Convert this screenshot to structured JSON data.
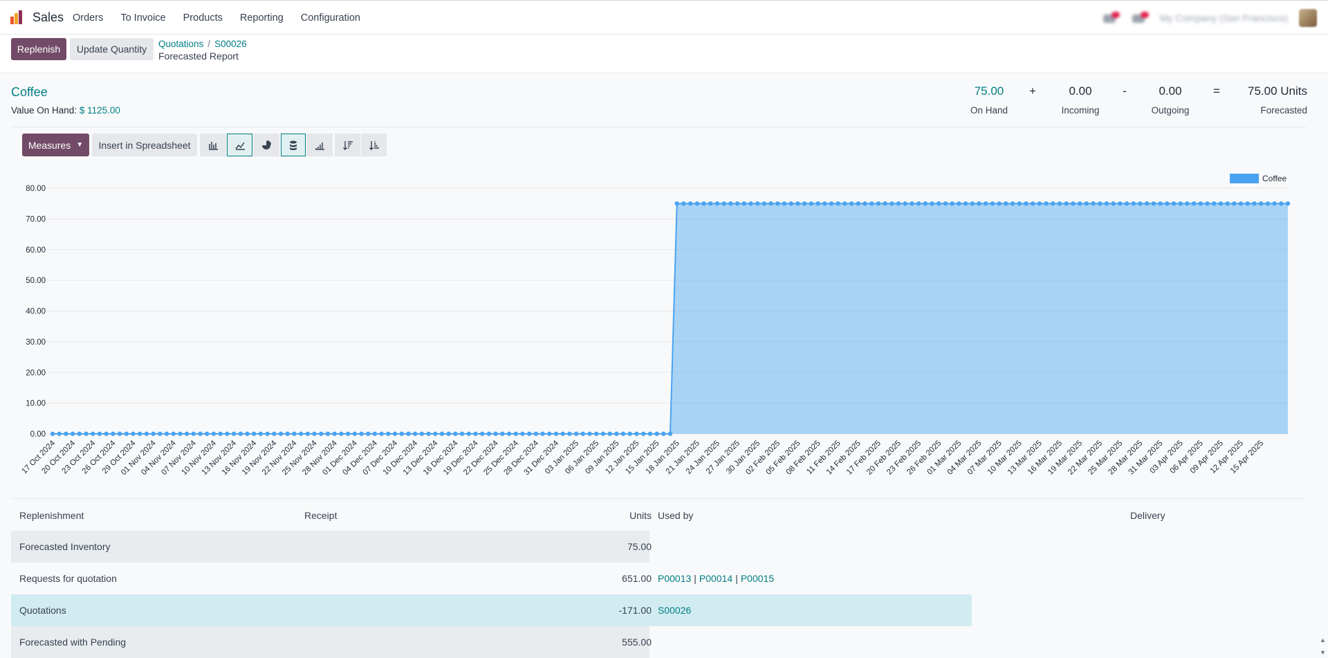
{
  "app": {
    "name": "Sales"
  },
  "menu": [
    "Orders",
    "To Invoice",
    "Products",
    "Reporting",
    "Configuration"
  ],
  "navbar_right": {
    "company": "My Company (San Francisco)"
  },
  "control": {
    "replenish_label": "Replenish",
    "update_quantity_label": "Update Quantity",
    "breadcrumb": [
      "Quotations",
      "S00026"
    ],
    "current": "Forecasted Report"
  },
  "product": {
    "name": "Coffee",
    "value_on_hand_label": "Value On Hand:",
    "value_on_hand": "$ 1125.00"
  },
  "summary": {
    "on_hand": {
      "value": "75.00",
      "label": "On Hand"
    },
    "plus": "+",
    "incoming": {
      "value": "0.00",
      "label": "Incoming"
    },
    "minus": "-",
    "outgoing": {
      "value": "0.00",
      "label": "Outgoing"
    },
    "equals": "=",
    "forecasted": {
      "value": "75.00 Units",
      "label": "Forecasted"
    }
  },
  "toolbar": {
    "measures_label": "Measures",
    "insert_label": "Insert in Spreadsheet",
    "icons": [
      "bar-chart-icon",
      "line-chart-icon",
      "pie-chart-icon",
      "stacked-icon",
      "cumulative-icon",
      "sort-descending-icon",
      "sort-ascending-icon"
    ]
  },
  "chart_data": {
    "type": "area",
    "series": [
      {
        "name": "Coffee",
        "color": "#4aa3f0",
        "step_date": "18 Jan 2025",
        "before": 0,
        "after": 75
      }
    ],
    "x_start": "17 Oct 2024",
    "x_end": "19 Apr 2025",
    "x_tick_labels": [
      "17 Oct 2024",
      "20 Oct 2024",
      "23 Oct 2024",
      "26 Oct 2024",
      "29 Oct 2024",
      "01 Nov 2024",
      "04 Nov 2024",
      "07 Nov 2024",
      "10 Nov 2024",
      "13 Nov 2024",
      "16 Nov 2024",
      "19 Nov 2024",
      "22 Nov 2024",
      "25 Nov 2024",
      "28 Nov 2024",
      "01 Dec 2024",
      "04 Dec 2024",
      "07 Dec 2024",
      "10 Dec 2024",
      "13 Dec 2024",
      "16 Dec 2024",
      "19 Dec 2024",
      "22 Dec 2024",
      "25 Dec 2024",
      "28 Dec 2024",
      "31 Dec 2024",
      "03 Jan 2025",
      "06 Jan 2025",
      "09 Jan 2025",
      "12 Jan 2025",
      "15 Jan 2025",
      "18 Jan 2025",
      "21 Jan 2025",
      "24 Jan 2025",
      "27 Jan 2025",
      "30 Jan 2025",
      "02 Feb 2025",
      "05 Feb 2025",
      "08 Feb 2025",
      "11 Feb 2025",
      "14 Feb 2025",
      "17 Feb 2025",
      "20 Feb 2025",
      "23 Feb 2025",
      "26 Feb 2025",
      "01 Mar 2025",
      "04 Mar 2025",
      "07 Mar 2025",
      "10 Mar 2025",
      "13 Mar 2025",
      "16 Mar 2025",
      "19 Mar 2025",
      "22 Mar 2025",
      "25 Mar 2025",
      "28 Mar 2025",
      "31 Mar 2025",
      "03 Apr 2025",
      "06 Apr 2025",
      "09 Apr 2025",
      "12 Apr 2025",
      "15 Apr 2025"
    ],
    "y_ticks": [
      "0.00",
      "10.00",
      "20.00",
      "30.00",
      "40.00",
      "50.00",
      "60.00",
      "70.00",
      "80.00"
    ],
    "ylim": [
      0,
      80
    ],
    "legend_position": "top-right",
    "grid": true
  },
  "table": {
    "headers": {
      "replenishment": "Replenishment",
      "receipt": "Receipt",
      "units": "Units",
      "used_by": "Used by",
      "delivery": "Delivery"
    },
    "rows": [
      {
        "replenishment": "Forecasted Inventory",
        "units": "75.00",
        "used_by": []
      },
      {
        "replenishment": "Requests for quotation",
        "units": "651.00",
        "used_by": [
          "P00013",
          "P00014",
          "P00015"
        ]
      },
      {
        "replenishment": "Quotations",
        "units": "-171.00",
        "used_by": [
          "S00026"
        ]
      },
      {
        "replenishment": "Forecasted with Pending",
        "units": "555.00",
        "used_by": []
      }
    ]
  },
  "colors": {
    "brand": "#714b67",
    "link": "#017e84",
    "series": "#4aa3f0",
    "highlight": "#d1ecf1"
  }
}
